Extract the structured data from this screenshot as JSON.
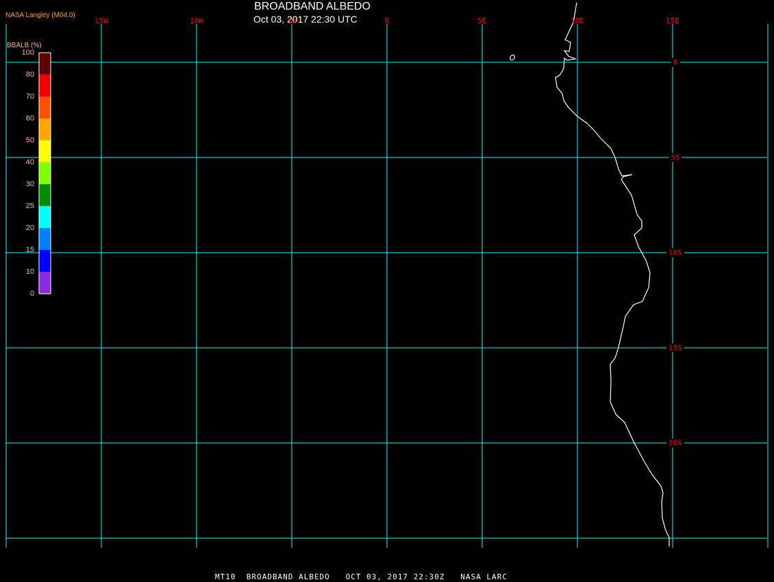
{
  "header": {
    "title": "BROADBAND ALBEDO",
    "subtitle": "Oct 03, 2017 22:30 UTC",
    "credit": "NASA Langley (M04.0)"
  },
  "grid": {
    "color": "#00ffff",
    "label_color": "#ff0000",
    "longitudes": [
      {
        "deg": -20,
        "label": ""
      },
      {
        "deg": -15,
        "label": "15W"
      },
      {
        "deg": -10,
        "label": "10W"
      },
      {
        "deg": -5,
        "label": "5W"
      },
      {
        "deg": 0,
        "label": "0"
      },
      {
        "deg": 5,
        "label": "5E"
      },
      {
        "deg": 10,
        "label": "10E"
      },
      {
        "deg": 15,
        "label": "15E"
      },
      {
        "deg": 20,
        "label": ""
      }
    ],
    "latitudes": [
      {
        "deg": 0,
        "label": "0"
      },
      {
        "deg": -5,
        "label": "5S"
      },
      {
        "deg": -10,
        "label": "10S"
      },
      {
        "deg": -15,
        "label": "15S"
      },
      {
        "deg": -20,
        "label": "20S"
      },
      {
        "deg": -25,
        "label": ""
      }
    ]
  },
  "colorbar": {
    "title": "BBALB (%)",
    "labels": [
      "100",
      "80",
      "70",
      "60",
      "50",
      "40",
      "30",
      "25",
      "20",
      "15",
      "10",
      "0"
    ],
    "colors": [
      "#600000",
      "#f00000",
      "#ff5000",
      "#ffa500",
      "#ffff00",
      "#80ff00",
      "#008c00",
      "#00ffff",
      "#0080ff",
      "#0000ff",
      "#8a2be2"
    ]
  },
  "coastline_color": "#ffffff",
  "footer": "MT10  BROADBAND ALBEDO   OCT 03, 2017 22:30Z   NASA LARC"
}
